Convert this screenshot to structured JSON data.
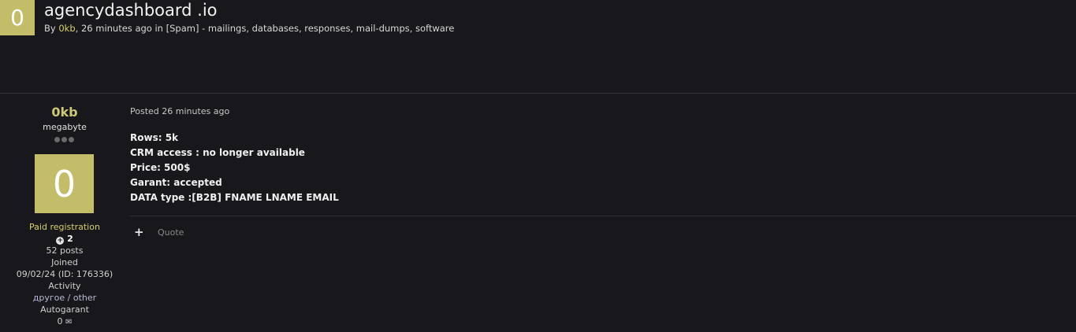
{
  "topic": {
    "avatar_letter": "0",
    "title": "agencydashboard .io",
    "by_prefix": "By ",
    "author": "0kb",
    "time_text": ", 26 minutes ago in ",
    "category": "[Spam] - mailings, databases, responses, mail-dumps, software"
  },
  "author_panel": {
    "name": "0kb",
    "rank": "megabyte",
    "avatar_letter": "0",
    "group": "Paid registration",
    "reputation": "2",
    "posts": "52 posts",
    "joined_label": "Joined",
    "joined_value": "09/02/24 (ID: 176336)",
    "activity_label": "Activity",
    "activity_value": "другое / other",
    "autogarant_label": "Autogarant",
    "autogarant_value": "0"
  },
  "post": {
    "date": "Posted 26 minutes ago",
    "lines": [
      "Rows: 5k",
      "CRM access : no longer available",
      "Price: 500$",
      "Garant: accepted",
      "DATA type :[B2B] FNAME LNAME EMAIL"
    ],
    "plus_label": "+",
    "quote_label": "Quote"
  },
  "colors": {
    "background": "#17171c",
    "accent": "#c3bd6a",
    "author_link": "#d9cf6a"
  }
}
